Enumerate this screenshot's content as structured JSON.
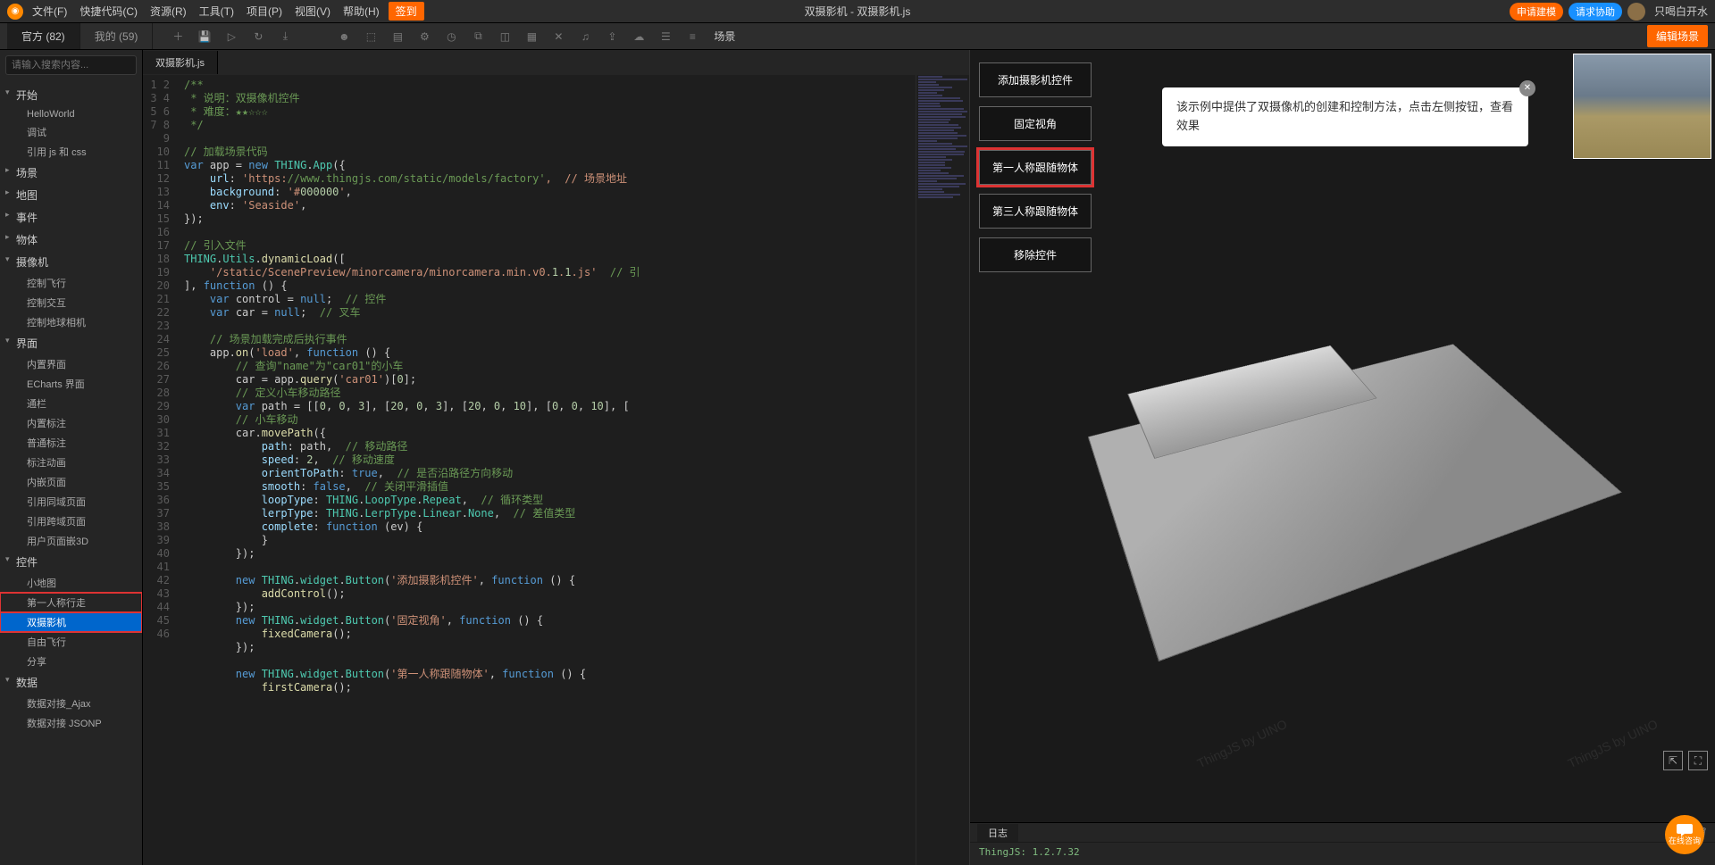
{
  "menubar": {
    "items": [
      "文件(F)",
      "快捷代码(C)",
      "资源(R)",
      "工具(T)",
      "项目(P)",
      "视图(V)",
      "帮助(H)"
    ],
    "sign": "签到",
    "title": "双摄影机 - 双摄影机.js",
    "apply": "申请建模",
    "assist": "请求协助",
    "user": "只喝白开水"
  },
  "sidebar_tabs": {
    "official": "官方 (82)",
    "mine": "我的 (59)"
  },
  "search_placeholder": "请输入搜索内容...",
  "scene_label": "场景",
  "edit_scene": "编辑场景",
  "file_tab": "双摄影机.js",
  "tree": [
    {
      "label": "开始",
      "open": true,
      "children": [
        "HelloWorld",
        "调试",
        "引用 js 和 css"
      ]
    },
    {
      "label": "场景",
      "open": false
    },
    {
      "label": "地图",
      "open": false
    },
    {
      "label": "事件",
      "open": false
    },
    {
      "label": "物体",
      "open": false
    },
    {
      "label": "摄像机",
      "open": true,
      "children": [
        "控制飞行",
        "控制交互",
        "控制地球相机"
      ]
    },
    {
      "label": "界面",
      "open": true,
      "children": [
        "内置界面",
        "ECharts 界面",
        "通栏",
        "内置标注",
        "普通标注",
        "标注动画",
        "内嵌页面",
        "引用同域页面",
        "引用跨域页面",
        "用户页面嵌3D"
      ]
    },
    {
      "label": "控件",
      "open": true,
      "children": [
        "小地图",
        "第一人称行走",
        "双摄影机",
        "自由飞行",
        "分享"
      ]
    },
    {
      "label": "数据",
      "open": true,
      "children": [
        "数据对接_Ajax",
        "数据对接 JSONP"
      ]
    }
  ],
  "code_lines": [
    "/**",
    " * 说明：双摄像机控件",
    " * 难度：★★☆☆☆",
    " */",
    "",
    "// 加载场景代码",
    "var app = new THING.App({",
    "    url: 'https://www.thingjs.com/static/models/factory',  // 场景地址",
    "    background: '#000000',",
    "    env: 'Seaside',",
    "});",
    "",
    "// 引入文件",
    "THING.Utils.dynamicLoad([",
    "    '/static/ScenePreview/minorcamera/minorcamera.min.v0.1.1.js'  // 引",
    "], function () {",
    "    var control = null;  // 控件",
    "    var car = null;  // 叉车",
    "",
    "    // 场景加载完成后执行事件",
    "    app.on('load', function () {",
    "        // 查询\"name\"为\"car01\"的小车",
    "        car = app.query('car01')[0];",
    "        // 定义小车移动路径",
    "        var path = [[0, 0, 3], [20, 0, 3], [20, 0, 10], [0, 0, 10], [",
    "        // 小车移动",
    "        car.movePath({",
    "            path: path,  // 移动路径",
    "            speed: 2,  // 移动速度",
    "            orientToPath: true,  // 是否沿路径方向移动",
    "            smooth: false,  // 关闭平滑插值",
    "            loopType: THING.LoopType.Repeat,  // 循环类型",
    "            lerpType: THING.LerpType.Linear.None,  // 差值类型",
    "            complete: function (ev) {",
    "            }",
    "        });",
    "",
    "        new THING.widget.Button('添加摄影机控件', function () {",
    "            addControl();",
    "        });",
    "        new THING.widget.Button('固定视角', function () {",
    "            fixedCamera();",
    "        });",
    "",
    "        new THING.widget.Button('第一人称跟随物体', function () {",
    "            firstCamera();"
  ],
  "overlay_buttons": [
    "添加摄影机控件",
    "固定视角",
    "第一人称跟随物体",
    "第三人称跟随物体",
    "移除控件"
  ],
  "tooltip": "该示例中提供了双摄像机的创建和控制方法，点击左侧按钮，查看效果",
  "watermark": "ThingJS by UINO",
  "log_tab": "日志",
  "log_text": "ThingJS: 1.2.7.32",
  "chat_label": "在线咨询"
}
